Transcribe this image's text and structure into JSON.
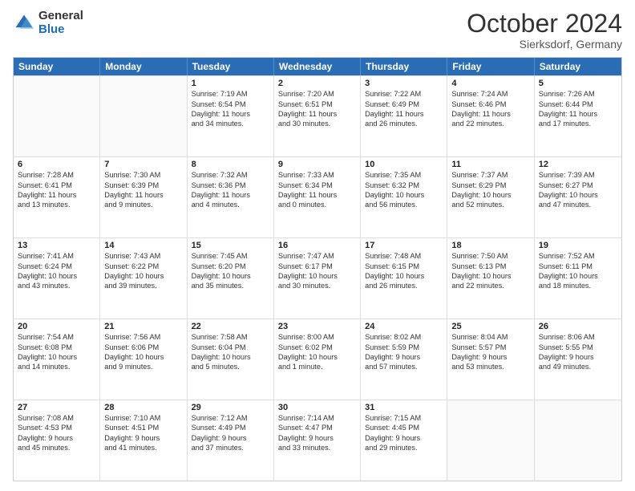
{
  "header": {
    "logo_general": "General",
    "logo_blue": "Blue",
    "month": "October 2024",
    "location": "Sierksdorf, Germany"
  },
  "days": [
    "Sunday",
    "Monday",
    "Tuesday",
    "Wednesday",
    "Thursday",
    "Friday",
    "Saturday"
  ],
  "rows": [
    [
      {
        "day": "",
        "lines": [],
        "empty": true
      },
      {
        "day": "",
        "lines": [],
        "empty": true
      },
      {
        "day": "1",
        "lines": [
          "Sunrise: 7:19 AM",
          "Sunset: 6:54 PM",
          "Daylight: 11 hours",
          "and 34 minutes."
        ]
      },
      {
        "day": "2",
        "lines": [
          "Sunrise: 7:20 AM",
          "Sunset: 6:51 PM",
          "Daylight: 11 hours",
          "and 30 minutes."
        ]
      },
      {
        "day": "3",
        "lines": [
          "Sunrise: 7:22 AM",
          "Sunset: 6:49 PM",
          "Daylight: 11 hours",
          "and 26 minutes."
        ]
      },
      {
        "day": "4",
        "lines": [
          "Sunrise: 7:24 AM",
          "Sunset: 6:46 PM",
          "Daylight: 11 hours",
          "and 22 minutes."
        ]
      },
      {
        "day": "5",
        "lines": [
          "Sunrise: 7:26 AM",
          "Sunset: 6:44 PM",
          "Daylight: 11 hours",
          "and 17 minutes."
        ]
      }
    ],
    [
      {
        "day": "6",
        "lines": [
          "Sunrise: 7:28 AM",
          "Sunset: 6:41 PM",
          "Daylight: 11 hours",
          "and 13 minutes."
        ]
      },
      {
        "day": "7",
        "lines": [
          "Sunrise: 7:30 AM",
          "Sunset: 6:39 PM",
          "Daylight: 11 hours",
          "and 9 minutes."
        ]
      },
      {
        "day": "8",
        "lines": [
          "Sunrise: 7:32 AM",
          "Sunset: 6:36 PM",
          "Daylight: 11 hours",
          "and 4 minutes."
        ]
      },
      {
        "day": "9",
        "lines": [
          "Sunrise: 7:33 AM",
          "Sunset: 6:34 PM",
          "Daylight: 11 hours",
          "and 0 minutes."
        ]
      },
      {
        "day": "10",
        "lines": [
          "Sunrise: 7:35 AM",
          "Sunset: 6:32 PM",
          "Daylight: 10 hours",
          "and 56 minutes."
        ]
      },
      {
        "day": "11",
        "lines": [
          "Sunrise: 7:37 AM",
          "Sunset: 6:29 PM",
          "Daylight: 10 hours",
          "and 52 minutes."
        ]
      },
      {
        "day": "12",
        "lines": [
          "Sunrise: 7:39 AM",
          "Sunset: 6:27 PM",
          "Daylight: 10 hours",
          "and 47 minutes."
        ]
      }
    ],
    [
      {
        "day": "13",
        "lines": [
          "Sunrise: 7:41 AM",
          "Sunset: 6:24 PM",
          "Daylight: 10 hours",
          "and 43 minutes."
        ]
      },
      {
        "day": "14",
        "lines": [
          "Sunrise: 7:43 AM",
          "Sunset: 6:22 PM",
          "Daylight: 10 hours",
          "and 39 minutes."
        ]
      },
      {
        "day": "15",
        "lines": [
          "Sunrise: 7:45 AM",
          "Sunset: 6:20 PM",
          "Daylight: 10 hours",
          "and 35 minutes."
        ]
      },
      {
        "day": "16",
        "lines": [
          "Sunrise: 7:47 AM",
          "Sunset: 6:17 PM",
          "Daylight: 10 hours",
          "and 30 minutes."
        ]
      },
      {
        "day": "17",
        "lines": [
          "Sunrise: 7:48 AM",
          "Sunset: 6:15 PM",
          "Daylight: 10 hours",
          "and 26 minutes."
        ]
      },
      {
        "day": "18",
        "lines": [
          "Sunrise: 7:50 AM",
          "Sunset: 6:13 PM",
          "Daylight: 10 hours",
          "and 22 minutes."
        ]
      },
      {
        "day": "19",
        "lines": [
          "Sunrise: 7:52 AM",
          "Sunset: 6:11 PM",
          "Daylight: 10 hours",
          "and 18 minutes."
        ]
      }
    ],
    [
      {
        "day": "20",
        "lines": [
          "Sunrise: 7:54 AM",
          "Sunset: 6:08 PM",
          "Daylight: 10 hours",
          "and 14 minutes."
        ]
      },
      {
        "day": "21",
        "lines": [
          "Sunrise: 7:56 AM",
          "Sunset: 6:06 PM",
          "Daylight: 10 hours",
          "and 9 minutes."
        ]
      },
      {
        "day": "22",
        "lines": [
          "Sunrise: 7:58 AM",
          "Sunset: 6:04 PM",
          "Daylight: 10 hours",
          "and 5 minutes."
        ]
      },
      {
        "day": "23",
        "lines": [
          "Sunrise: 8:00 AM",
          "Sunset: 6:02 PM",
          "Daylight: 10 hours",
          "and 1 minute."
        ]
      },
      {
        "day": "24",
        "lines": [
          "Sunrise: 8:02 AM",
          "Sunset: 5:59 PM",
          "Daylight: 9 hours",
          "and 57 minutes."
        ]
      },
      {
        "day": "25",
        "lines": [
          "Sunrise: 8:04 AM",
          "Sunset: 5:57 PM",
          "Daylight: 9 hours",
          "and 53 minutes."
        ]
      },
      {
        "day": "26",
        "lines": [
          "Sunrise: 8:06 AM",
          "Sunset: 5:55 PM",
          "Daylight: 9 hours",
          "and 49 minutes."
        ]
      }
    ],
    [
      {
        "day": "27",
        "lines": [
          "Sunrise: 7:08 AM",
          "Sunset: 4:53 PM",
          "Daylight: 9 hours",
          "and 45 minutes."
        ]
      },
      {
        "day": "28",
        "lines": [
          "Sunrise: 7:10 AM",
          "Sunset: 4:51 PM",
          "Daylight: 9 hours",
          "and 41 minutes."
        ]
      },
      {
        "day": "29",
        "lines": [
          "Sunrise: 7:12 AM",
          "Sunset: 4:49 PM",
          "Daylight: 9 hours",
          "and 37 minutes."
        ]
      },
      {
        "day": "30",
        "lines": [
          "Sunrise: 7:14 AM",
          "Sunset: 4:47 PM",
          "Daylight: 9 hours",
          "and 33 minutes."
        ]
      },
      {
        "day": "31",
        "lines": [
          "Sunrise: 7:15 AM",
          "Sunset: 4:45 PM",
          "Daylight: 9 hours",
          "and 29 minutes."
        ]
      },
      {
        "day": "",
        "lines": [],
        "empty": true
      },
      {
        "day": "",
        "lines": [],
        "empty": true
      }
    ]
  ]
}
